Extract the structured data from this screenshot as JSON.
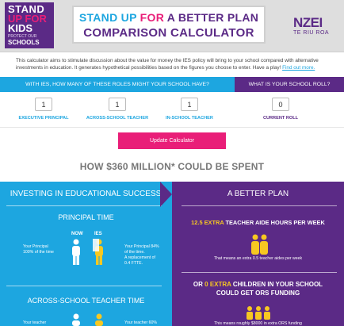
{
  "header": {
    "logo_left": {
      "line1": "STAND",
      "line2": "UP FOR",
      "line3": "KIDS",
      "line4": "PROTECT OUR",
      "line5": "SCHOOLS"
    },
    "title_line1_a": "STAND UP ",
    "title_line1_b": "FOR ",
    "title_line1_c": "A BETTER PLAN",
    "title_line2": "COMPARISON CALCULATOR",
    "logo_right": {
      "name": "NZEI",
      "tagline": "TE RIU ROA"
    }
  },
  "intro": {
    "text": "This calculator aims to stimulate discussion about the value for money the IES policy will bring to your school compared with alternative investments in education. It generates hypothetical possibilities based on the figures you choose to enter. Have a play! ",
    "link": "Find out more."
  },
  "questions": {
    "roles_question": "WITH IES, HOW MANY OF THESE ROLES MIGHT YOUR SCHOOL HAVE?",
    "roll_question": "WHAT IS YOUR SCHOOL ROLL?"
  },
  "inputs": {
    "executive_principal": {
      "value": "1",
      "label": "EXECUTIVE PRINCIPAL"
    },
    "across_school_teacher": {
      "value": "1",
      "label": "ACROSS-SCHOOL TEACHER"
    },
    "in_school_teacher": {
      "value": "1",
      "label": "IN-SCHOOL TEACHER"
    },
    "current_roll": {
      "value": "0",
      "label": "CURRENT ROLL"
    }
  },
  "update_button": "Update Calculator",
  "spent_title": "HOW $360 MILLION* COULD BE SPENT",
  "left_panel": {
    "heading": "INVESTING IN EDUCATIONAL SUCCESS",
    "principal_time": {
      "title": "PRINCIPAL TIME",
      "col_now": "NOW",
      "col_ies": "IES",
      "left_note_l1": "Your Principal",
      "left_note_l2": "100% of the time",
      "right_note_l1": "Your Principal 84%",
      "right_note_l2": "of the time.",
      "right_note_l3": "A replacement of",
      "right_note_l4": "0.4 FTTE."
    },
    "teacher_time": {
      "title": "ACROSS-SCHOOL TEACHER TIME",
      "left_note": "Your teacher",
      "right_note": "Your teacher 60%"
    }
  },
  "right_panel": {
    "heading": "A BETTER PLAN",
    "hours_value": "12.5 EXTRA",
    "hours_text": " TEACHER AIDE HOURS PER WEEK",
    "hours_note": "That means an extra 0.5 teacher aides per week",
    "ors_prefix": "OR ",
    "ors_value": "0 EXTRA",
    "ors_text": " CHILDREN IN YOUR SCHOOL COULD GET ORS FUNDING",
    "ors_note": "This means roughly $8000 in extra ORS funding"
  },
  "colors": {
    "blue": "#1da6e0",
    "purple": "#5b2a86",
    "pink": "#e91e78",
    "yellow": "#f7c821"
  }
}
